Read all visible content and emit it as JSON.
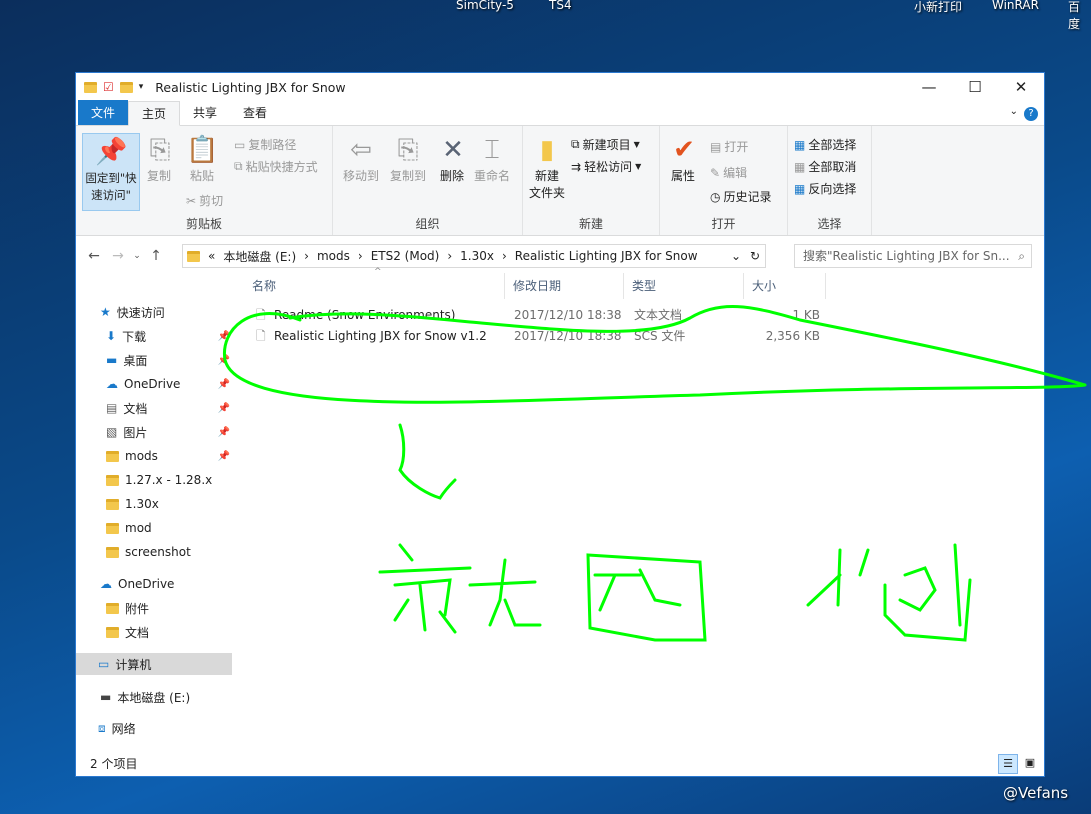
{
  "desktop": {
    "icons": [
      "SimCity-5",
      "TS4",
      "小新打印",
      "WinRAR",
      "百度"
    ],
    "watermark": "@Vefans"
  },
  "window": {
    "title": "Realistic Lighting JBX for Snow"
  },
  "tabs": [
    "文件",
    "主页",
    "共享",
    "查看"
  ],
  "ribbon": {
    "clipboard": {
      "label": "剪贴板",
      "pin": "固定到\"快速访问\"",
      "copy": "复制",
      "paste": "粘贴",
      "copy_path": "复制路径",
      "paste_shortcut": "粘贴快捷方式",
      "cut": "剪切"
    },
    "organize": {
      "label": "组织",
      "move_to": "移动到",
      "copy_to": "复制到",
      "delete": "删除",
      "rename": "重命名"
    },
    "new": {
      "label": "新建",
      "new_folder": "新建\n文件夹",
      "new_item": "新建项目",
      "easy_access": "轻松访问"
    },
    "open": {
      "label": "打开",
      "properties": "属性",
      "open": "打开",
      "edit": "编辑",
      "history": "历史记录"
    },
    "select": {
      "label": "选择",
      "select_all": "全部选择",
      "select_none": "全部取消",
      "invert": "反向选择"
    }
  },
  "address": {
    "crumbs": [
      "本地磁盘 (E:)",
      "mods",
      "ETS2 (Mod)",
      "1.30x",
      "Realistic Lighting JBX for Snow"
    ],
    "search_placeholder": "搜索\"Realistic Lighting JBX for Sn..."
  },
  "nav": [
    {
      "label": "快速访问",
      "pinned": false
    },
    {
      "label": "下载",
      "pinned": true
    },
    {
      "label": "桌面",
      "pinned": true
    },
    {
      "label": "OneDrive",
      "pinned": true
    },
    {
      "label": "文档",
      "pinned": true
    },
    {
      "label": "图片",
      "pinned": true
    },
    {
      "label": "mods",
      "pinned": true
    },
    {
      "label": "1.27.x - 1.28.x",
      "pinned": false
    },
    {
      "label": "1.30x",
      "pinned": false
    },
    {
      "label": "mod",
      "pinned": false
    },
    {
      "label": "screenshot",
      "pinned": false
    },
    {
      "label": "OneDrive",
      "pinned": false
    },
    {
      "label": "附件",
      "pinned": false
    },
    {
      "label": "文档",
      "pinned": false
    },
    {
      "label": "计算机",
      "pinned": false
    },
    {
      "label": "本地磁盘 (E:)",
      "pinned": false
    },
    {
      "label": "网络",
      "pinned": false
    }
  ],
  "columns": [
    "名称",
    "修改日期",
    "类型",
    "大小"
  ],
  "files": [
    {
      "name": "Readme (Snow Environments)",
      "date": "2017/12/10 18:38",
      "type": "文本文档",
      "size": "1 KB"
    },
    {
      "name": "Realistic Lighting JBX for Snow v1.2",
      "date": "2017/12/10 18:38",
      "type": "SCS 文件",
      "size": "2,356 KB"
    }
  ],
  "status": {
    "count": "2 个项目"
  },
  "annotation": {
    "handwriting": "就四個",
    "color": "#00ff00"
  }
}
